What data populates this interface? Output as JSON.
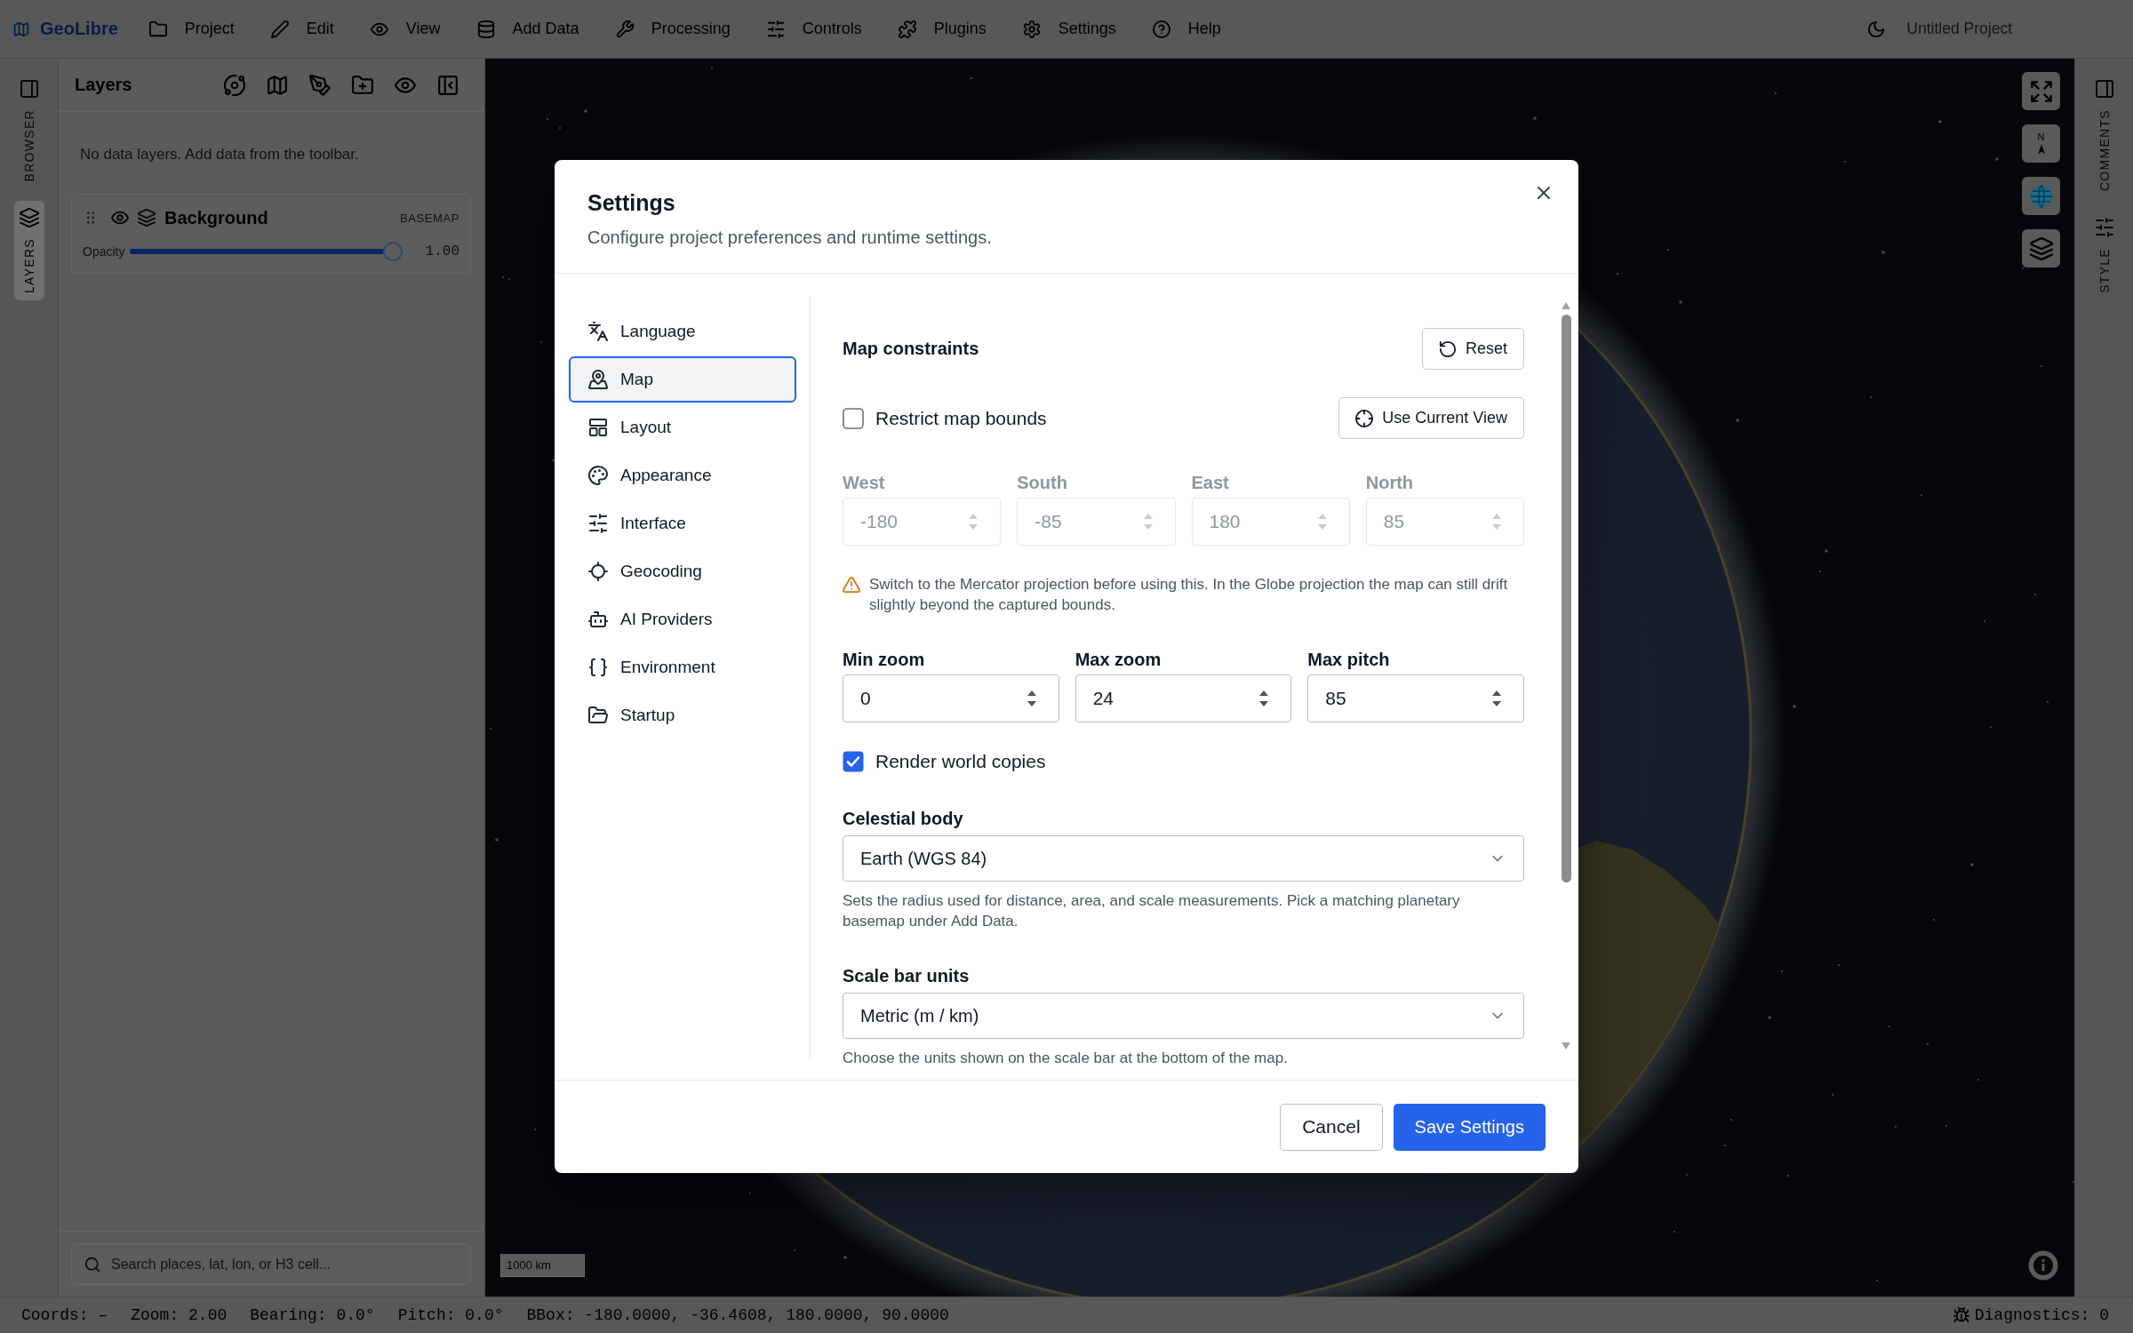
{
  "app_bar": {
    "logo": "GeoLibre",
    "menus": [
      "Project",
      "Edit",
      "View",
      "Add Data",
      "Processing",
      "Controls",
      "Plugins",
      "Settings",
      "Help"
    ],
    "project_name": "Untitled Project"
  },
  "left_rail": [
    {
      "label": "BROWSER",
      "selected": false
    },
    {
      "label": "LAYERS",
      "selected": true
    }
  ],
  "layers_panel": {
    "title": "Layers",
    "empty_message": "No data layers. Add data from the toolbar.",
    "layers": [
      {
        "name": "Background",
        "tag": "BASEMAP",
        "opacity_label": "Opacity",
        "level": 1,
        "reading": "1.00"
      }
    ],
    "search": {
      "placeholder": "Search places, lat, lon, or H3 cell..."
    }
  },
  "map": {
    "compass_label": "N",
    "scale_bar": "1000 km"
  },
  "right_rail": [
    {
      "label": "COMMENTS",
      "selected": false
    },
    {
      "label": "STYLE",
      "selected": false
    }
  ],
  "status_bar": {
    "items": [
      "Coords: –",
      "Zoom: 2.00",
      "Bearing: 0.0°",
      "Pitch: 0.0°",
      "BBox: -180.0000, -36.4608, 180.0000, 90.0000"
    ],
    "diagnostics": "Diagnostics: 0"
  },
  "dialog": {
    "title": "Settings",
    "subtitle": "Configure project preferences and runtime settings.",
    "nav": [
      {
        "label": "Language",
        "selected": false
      },
      {
        "label": "Map",
        "selected": true
      },
      {
        "label": "Layout",
        "selected": false
      },
      {
        "label": "Appearance",
        "selected": false
      },
      {
        "label": "Interface",
        "selected": false
      },
      {
        "label": "Geocoding",
        "selected": false
      },
      {
        "label": "AI Providers",
        "selected": false
      },
      {
        "label": "Environment",
        "selected": false
      },
      {
        "label": "Startup",
        "selected": false
      }
    ],
    "section_title": "Map constraints",
    "reset_button": "Reset",
    "restrict_bounds": {
      "label": "Restrict map bounds",
      "checked": false
    },
    "use_current_view_button": "Use Current View",
    "bounds_fields": [
      {
        "label": "West",
        "value": "-180",
        "disabled": true
      },
      {
        "label": "South",
        "value": "-85",
        "disabled": true
      },
      {
        "label": "East",
        "value": "180",
        "disabled": true
      },
      {
        "label": "North",
        "value": "85",
        "disabled": true
      }
    ],
    "warning": "Switch to the Mercator projection before using this. In the Globe projection the map can still drift slightly beyond the captured bounds.",
    "zoom_fields": [
      {
        "label": "Min zoom",
        "value": "0",
        "disabled": false
      },
      {
        "label": "Max zoom",
        "value": "24",
        "disabled": false
      },
      {
        "label": "Max pitch",
        "value": "85",
        "disabled": false
      }
    ],
    "world_copies": {
      "label": "Render world copies",
      "checked": true
    },
    "selects": [
      {
        "label": "Celestial body",
        "value": "Earth (WGS 84)",
        "help": "Sets the radius used for distance, area, and scale measurements. Pick a matching planetary basemap under Add Data."
      },
      {
        "label": "Scale bar units",
        "value": "Metric (m / km)",
        "help": "Choose the units shown on the scale bar at the bottom of the map."
      }
    ],
    "buttons": [
      {
        "label": "Cancel",
        "kind": "secondary"
      },
      {
        "label": "Save Settings",
        "kind": "primary"
      }
    ]
  }
}
